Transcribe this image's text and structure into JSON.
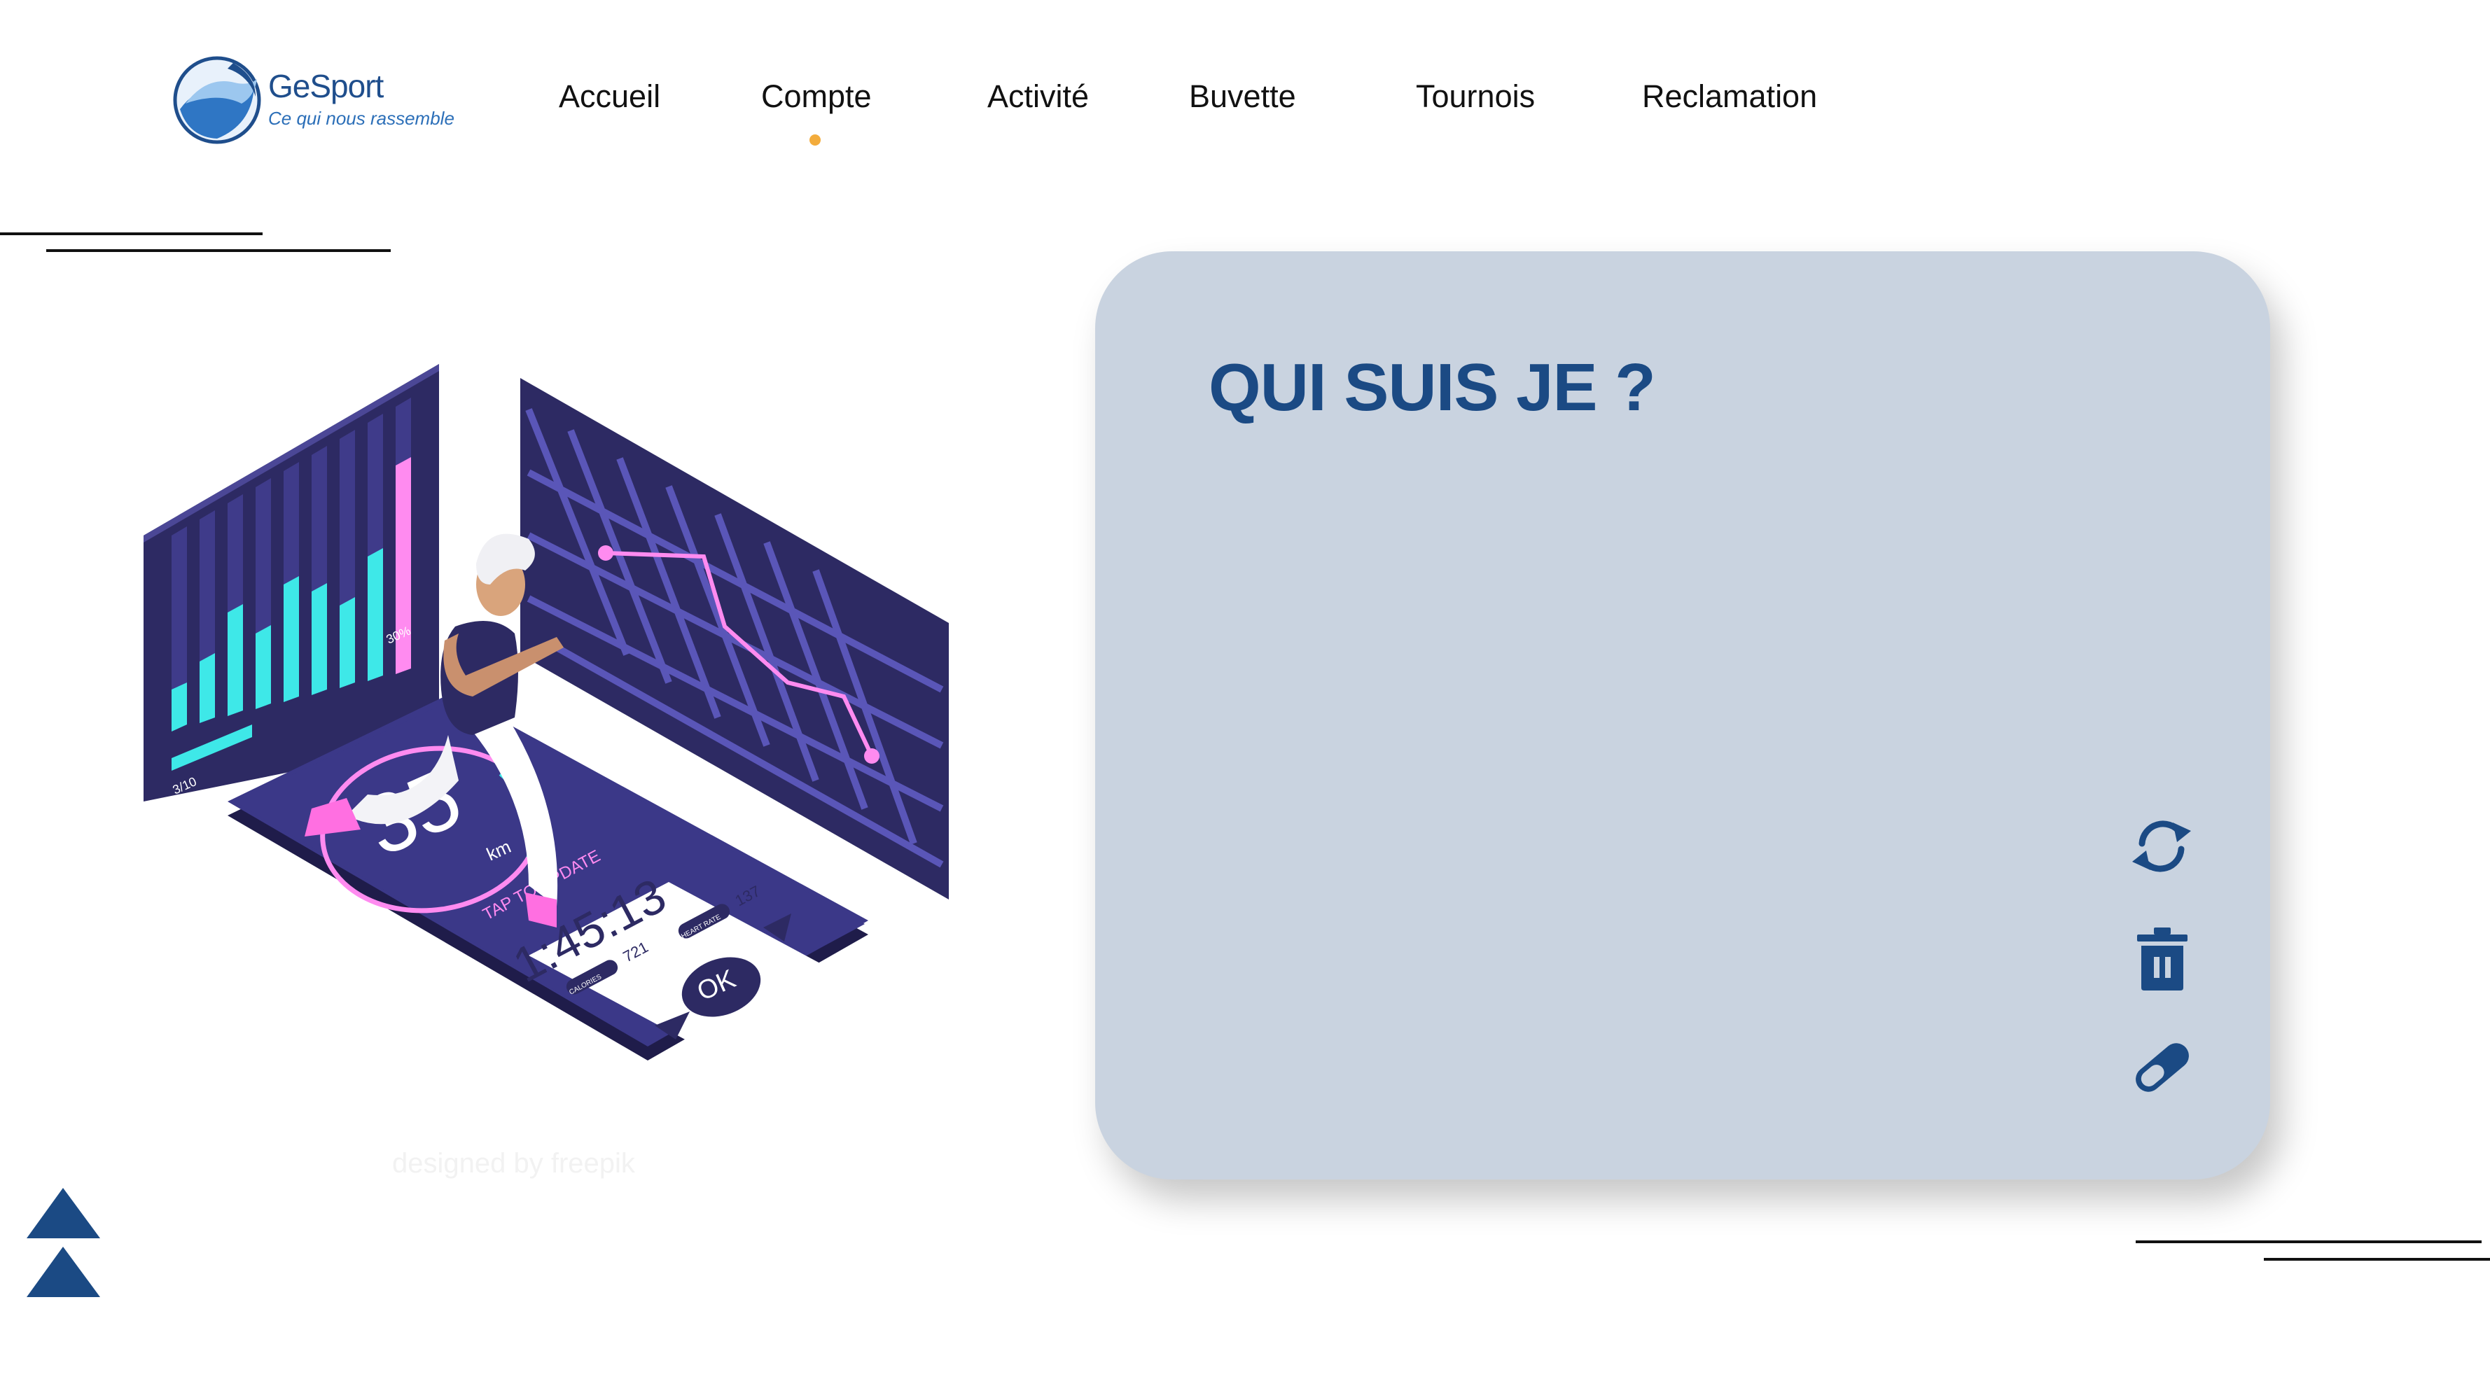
{
  "brand": {
    "name": "GeSport",
    "tagline": "Ce qui nous rassemble"
  },
  "nav": {
    "items": [
      {
        "label": "Accueil"
      },
      {
        "label": "Compte"
      },
      {
        "label": "Activité"
      },
      {
        "label": "Buvette"
      },
      {
        "label": "Tournois"
      },
      {
        "label": "Reclamation"
      }
    ],
    "active_index": 1
  },
  "card": {
    "title": "QUI SUIS JE ?",
    "actions": [
      {
        "icon": "refresh-icon"
      },
      {
        "icon": "trash-icon"
      },
      {
        "icon": "edit-icon"
      }
    ]
  },
  "illustration": {
    "distance_value": "35",
    "distance_unit": "km",
    "tap_text": "TAP TO UPDATE",
    "time": "1:45:13",
    "calories_label": "CALORIES",
    "calories_value": "721",
    "heart_label": "HEART RATE",
    "heart_value": "137",
    "ok_label": "OK",
    "chart_percent": "30%",
    "chart_progress": "3/10"
  },
  "watermark": "designed by freepik",
  "scroll": {
    "icons": [
      "chevron-up-icon",
      "chevron-up-icon"
    ]
  },
  "colors": {
    "brand_blue": "#1b4a84",
    "card_bg": "#c9d3e0",
    "active_dot": "#f3ac3c",
    "illu_dark": "#2d2a63",
    "illu_cyan": "#3ee8e8",
    "illu_pink": "#ff6fe1"
  }
}
